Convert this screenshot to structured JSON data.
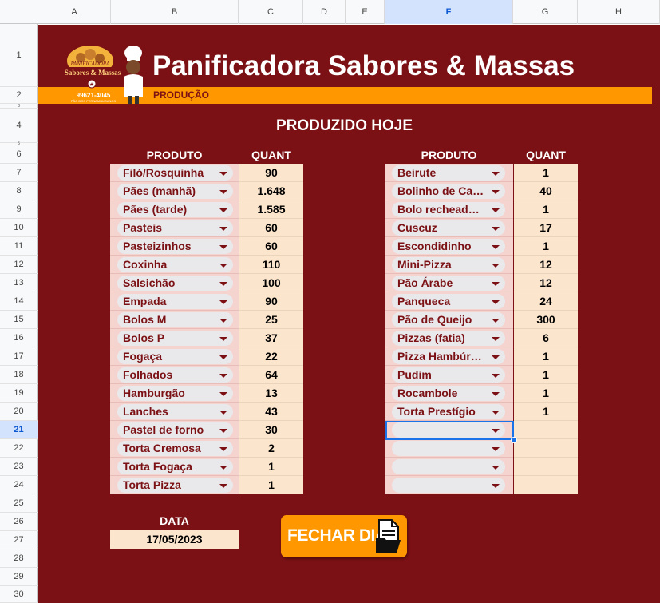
{
  "columns": [
    "A",
    "B",
    "C",
    "D",
    "E",
    "F",
    "G",
    "H"
  ],
  "selected_column": "F",
  "rows": [
    "1",
    "2",
    "3",
    "4",
    "5",
    "6",
    "7",
    "8",
    "9",
    "10",
    "11",
    "12",
    "13",
    "14",
    "15",
    "16",
    "17",
    "18",
    "19",
    "20",
    "21",
    "22",
    "23",
    "24",
    "25",
    "26",
    "27",
    "28",
    "29",
    "30"
  ],
  "selected_row": "21",
  "header": {
    "title": "Panificadora Sabores & Massas",
    "section": "PRODUÇÃO",
    "logo_top": "PANIFICADORA",
    "logo_name": "Sabores & Massas",
    "logo_phone": "99621-4045",
    "logo_tagline": "PÃO DOS PERNAMBUCANOS"
  },
  "subtitle": "PRODUZIDO HOJE",
  "left_table": {
    "col_product": "PRODUTO",
    "col_qty": "QUANT",
    "rows": [
      {
        "product": "Filó/Rosquinha",
        "qty": "90"
      },
      {
        "product": "Pães (manhã)",
        "qty": "1.648"
      },
      {
        "product": "Pães (tarde)",
        "qty": "1.585"
      },
      {
        "product": "Pasteis",
        "qty": "60"
      },
      {
        "product": "Pasteizinhos",
        "qty": "60"
      },
      {
        "product": "Coxinha",
        "qty": "110"
      },
      {
        "product": "Salsichão",
        "qty": "100"
      },
      {
        "product": "Empada",
        "qty": "90"
      },
      {
        "product": "Bolos M",
        "qty": "25"
      },
      {
        "product": "Bolos P",
        "qty": "37"
      },
      {
        "product": "Fogaça",
        "qty": "22"
      },
      {
        "product": "Folhados",
        "qty": "64"
      },
      {
        "product": "Hamburgão",
        "qty": "13"
      },
      {
        "product": "Lanches",
        "qty": "43"
      },
      {
        "product": "Pastel de forno",
        "qty": "30"
      },
      {
        "product": "Torta Cremosa",
        "qty": "2"
      },
      {
        "product": "Torta Fogaça",
        "qty": "1"
      },
      {
        "product": "Torta Pizza",
        "qty": "1"
      }
    ]
  },
  "right_table": {
    "col_product": "PRODUTO",
    "col_qty": "QUANT",
    "rows": [
      {
        "product": "Beirute",
        "qty": "1"
      },
      {
        "product": "Bolinho de Ca…",
        "qty": "40"
      },
      {
        "product": "Bolo rechead…",
        "qty": "1"
      },
      {
        "product": "Cuscuz",
        "qty": "17"
      },
      {
        "product": "Escondidinho",
        "qty": "1"
      },
      {
        "product": "Mini-Pizza",
        "qty": "12"
      },
      {
        "product": "Pão Árabe",
        "qty": "12"
      },
      {
        "product": "Panqueca",
        "qty": "24"
      },
      {
        "product": "Pão de Queijo",
        "qty": "300"
      },
      {
        "product": "Pizzas (fatia)",
        "qty": "6"
      },
      {
        "product": "Pizza Hambúr…",
        "qty": "1"
      },
      {
        "product": "Pudim",
        "qty": "1"
      },
      {
        "product": "Rocambole",
        "qty": "1"
      },
      {
        "product": "Torta Prestígio",
        "qty": "1"
      },
      {
        "product": "",
        "qty": ""
      },
      {
        "product": "",
        "qty": ""
      },
      {
        "product": "",
        "qty": ""
      },
      {
        "product": "",
        "qty": ""
      }
    ]
  },
  "date": {
    "label": "DATA",
    "value": "17/05/2023"
  },
  "close_button": {
    "label": "FECHAR DIA"
  },
  "colors": {
    "sheet_bg": "#7b1114",
    "accent": "#ff9800",
    "product_cell": "#f5d3cf",
    "qty_cell": "#fce5cd",
    "selection": "#1a73e8"
  }
}
